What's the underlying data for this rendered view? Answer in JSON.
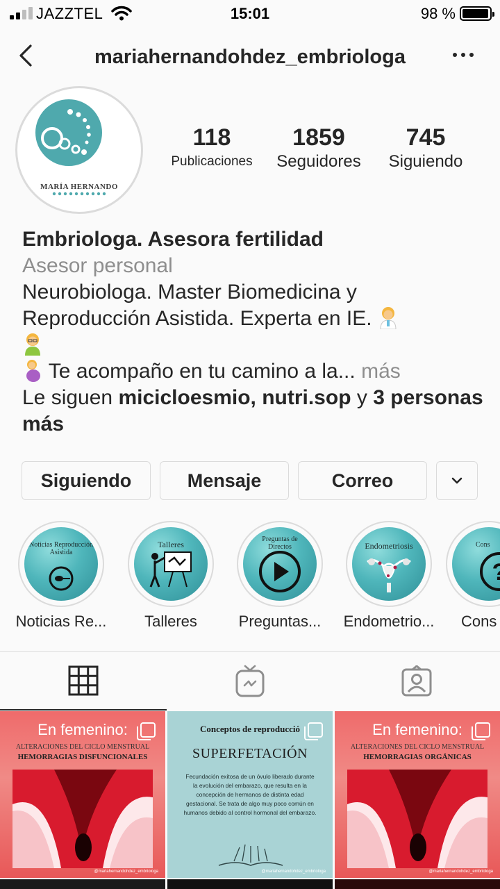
{
  "status_bar": {
    "carrier": "JAZZTEL",
    "time": "15:01",
    "battery_percent": "98 %",
    "battery_level": 0.98
  },
  "header": {
    "username": "mariahernandohdez_embriologa",
    "back_icon": "chevron-left-icon",
    "more_icon": "more-horizontal-icon"
  },
  "profile": {
    "avatar_text": "MARÍA HERNANDO",
    "stats": [
      {
        "value": "118",
        "label": "Publicaciones"
      },
      {
        "value": "1859",
        "label": "Seguidores"
      },
      {
        "value": "745",
        "label": "Siguiendo"
      }
    ],
    "display_name": "Embriologa. Asesora fertilidad",
    "category": "Asesor personal",
    "bio_line1": "Neurobiologa. Master Biomedicina y",
    "bio_line2": "Reproducción Asistida. Experta en IE.",
    "bio_line3": "Te acompaño en tu camino a la...",
    "more_link": "más",
    "followed_by_prefix": "Le siguen",
    "followed_by_users": "micicloesmio, nutri.sop",
    "followed_by_joiner": "y",
    "followed_by_rest": "3 personas más"
  },
  "actions": {
    "following": "Siguiendo",
    "message": "Mensaje",
    "email": "Correo",
    "dropdown_icon": "chevron-down-icon"
  },
  "highlights": [
    {
      "label": "Noticias Re...",
      "cover_title": "Noticias Reproducción Asistida"
    },
    {
      "label": "Talleres",
      "cover_title": "Talleres"
    },
    {
      "label": "Preguntas...",
      "cover_title": "Preguntas de Directos"
    },
    {
      "label": "Endometrio...",
      "cover_title": "Endometriosis"
    },
    {
      "label": "Cons",
      "cover_title": "Cons"
    }
  ],
  "tabs": [
    {
      "name": "grid",
      "icon": "grid-icon",
      "active": true
    },
    {
      "name": "igtv",
      "icon": "igtv-icon",
      "active": false
    },
    {
      "name": "tagged",
      "icon": "tagged-icon",
      "active": false
    }
  ],
  "posts": [
    {
      "header": "En femenino:",
      "subtitle": "ALTERACIONES DEL CICLO MENSTRUAL",
      "title": "HEMORRAGIAS DISFUNCIONALES",
      "credit": "@mariahernandohdez_embriologa"
    },
    {
      "title": "Conceptos de reproducció",
      "heading": "SUPERFETACIÓN",
      "text": "Fecundación exitosa de un óvulo liberado durante la evolución del embarazo, que resulta en la concepción de hermanos de distinta edad gestacional. Se trata de algo muy poco común en humanos debido al control hormonal del embarazo.",
      "credit": "@mariahernandohdez_embriologa"
    },
    {
      "header": "En femenino:",
      "subtitle": "ALTERACIONES DEL CICLO MENSTRUAL",
      "title": "HEMORRAGIAS ORGÁNICAS",
      "credit": "@mariahernandohdez_embriologa"
    }
  ],
  "colors": {
    "brand_teal": "#4fb6bb",
    "post_red": "#ef6b6b",
    "post_teal": "#a9d3d5"
  }
}
